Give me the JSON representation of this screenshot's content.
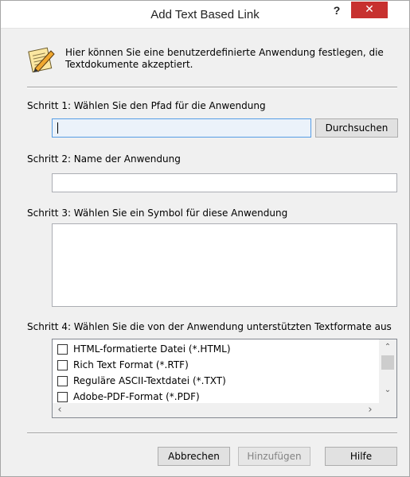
{
  "window": {
    "title": "Add Text Based Link",
    "help_label": "?",
    "close_label": "✕",
    "close_color": "#c7312f"
  },
  "intro": {
    "icon": "notepad-pencil-icon",
    "text": "Hier können Sie eine benutzerdefinierte Anwendung festlegen, die Textdokumente akzeptiert."
  },
  "step1": {
    "label": "Schritt 1: Wählen Sie den Pfad für die Anwendung",
    "path_value": "",
    "browse_label": "Durchsuchen"
  },
  "step2": {
    "label": "Schritt 2: Name der Anwendung",
    "name_value": ""
  },
  "step3": {
    "label": "Schritt 3: Wählen Sie ein Symbol für diese Anwendung"
  },
  "step4": {
    "label": "Schritt 4: Wählen Sie die von der Anwendung unterstützten Textformate aus",
    "formats": [
      {
        "label": "HTML-formatierte Datei (*.HTML)",
        "checked": false
      },
      {
        "label": "Rich Text Format (*.RTF)",
        "checked": false
      },
      {
        "label": "Reguläre ASCII-Textdatei (*.TXT)",
        "checked": false
      },
      {
        "label": "Adobe-PDF-Format (*.PDF)",
        "checked": false
      }
    ]
  },
  "buttons": {
    "cancel": "Abbrechen",
    "add": "Hinzufügen",
    "help": "Hilfe"
  }
}
